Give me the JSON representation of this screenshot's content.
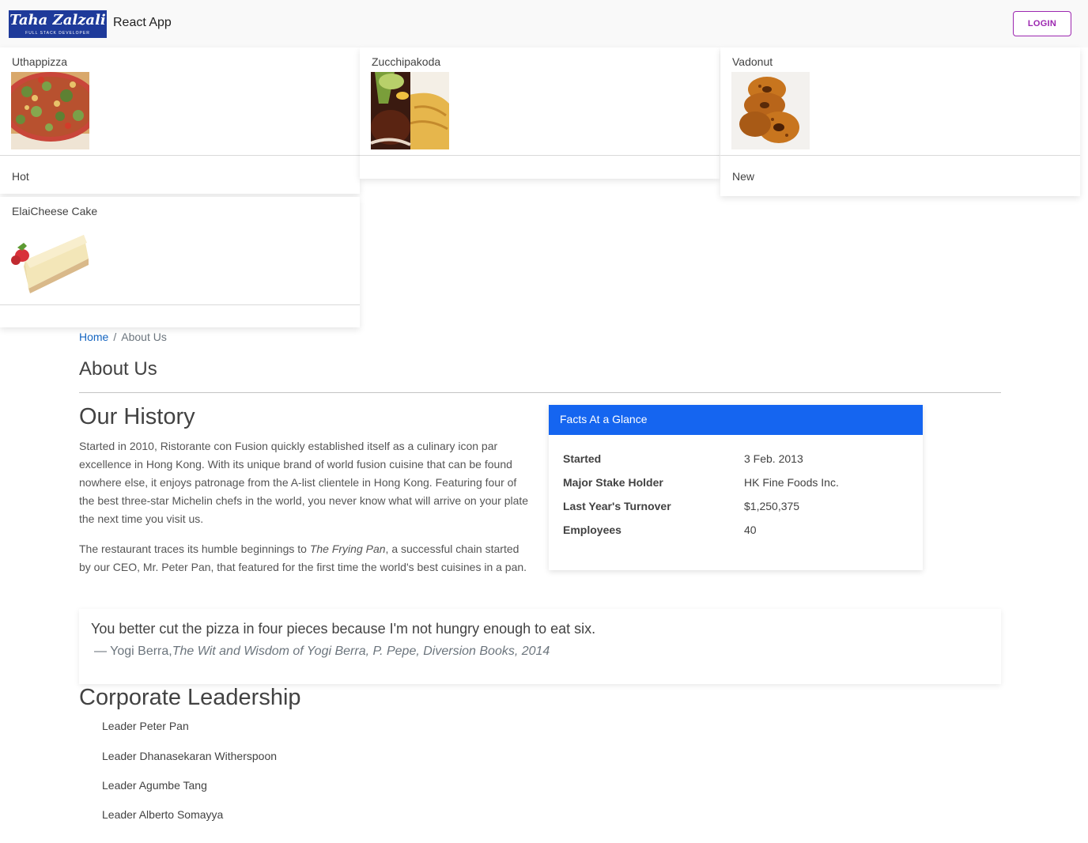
{
  "header": {
    "logo_name": "Taha Zalzali",
    "logo_tagline": "FULL STACK DEVELOPER",
    "app_title": "React App",
    "login_label": "LOGIN"
  },
  "cards": [
    {
      "name": "Uthappizza",
      "image": "pizza-image",
      "label": "Hot"
    },
    {
      "name": "Zucchipakoda",
      "image": "pakoda-image",
      "label": ""
    },
    {
      "name": "Vadonut",
      "image": "donut-image",
      "label": "New"
    },
    {
      "name": "ElaiCheese Cake",
      "image": "cheesecake-image",
      "label": ""
    }
  ],
  "breadcrumb": {
    "home": "Home",
    "separator": "/",
    "current": "About Us"
  },
  "page_title": "About Us",
  "history": {
    "heading": "Our History",
    "para1": "Started in 2010, Ristorante con Fusion quickly established itself as a culinary icon par excellence in Hong Kong. With its unique brand of world fusion cuisine that can be found nowhere else, it enjoys patronage from the A-list clientele in Hong Kong. Featuring four of the best three-star Michelin chefs in the world, you never know what will arrive on your plate the next time you visit us.",
    "para2_before": "The restaurant traces its humble beginnings to ",
    "para2_italic": "The Frying Pan",
    "para2_after": ", a successful chain started by our CEO, Mr. Peter Pan, that featured for the first time the world's best cuisines in a pan."
  },
  "facts": {
    "title": "Facts At a Glance",
    "rows": [
      {
        "key": "Started",
        "value": "3 Feb. 2013"
      },
      {
        "key": "Major Stake Holder",
        "value": "HK Fine Foods Inc."
      },
      {
        "key": "Last Year's Turnover",
        "value": "$1,250,375"
      },
      {
        "key": "Employees",
        "value": "40"
      }
    ]
  },
  "quote": {
    "text": "You better cut the pizza in four pieces because I'm not hungry enough to eat six.",
    "author": "— Yogi Berra,",
    "source": "The Wit and Wisdom of Yogi Berra, P. Pepe, Diversion Books, 2014"
  },
  "leadership": {
    "heading": "Corporate Leadership",
    "leaders": [
      "Leader Peter Pan",
      "Leader Dhanasekaran Witherspoon",
      "Leader Agumbe Tang",
      "Leader Alberto Somayya"
    ]
  },
  "colors": {
    "facts_header": "#1565f0",
    "login_accent": "#9c27b0",
    "link": "#1565c0",
    "logo_bg": "#1e3a9a"
  }
}
